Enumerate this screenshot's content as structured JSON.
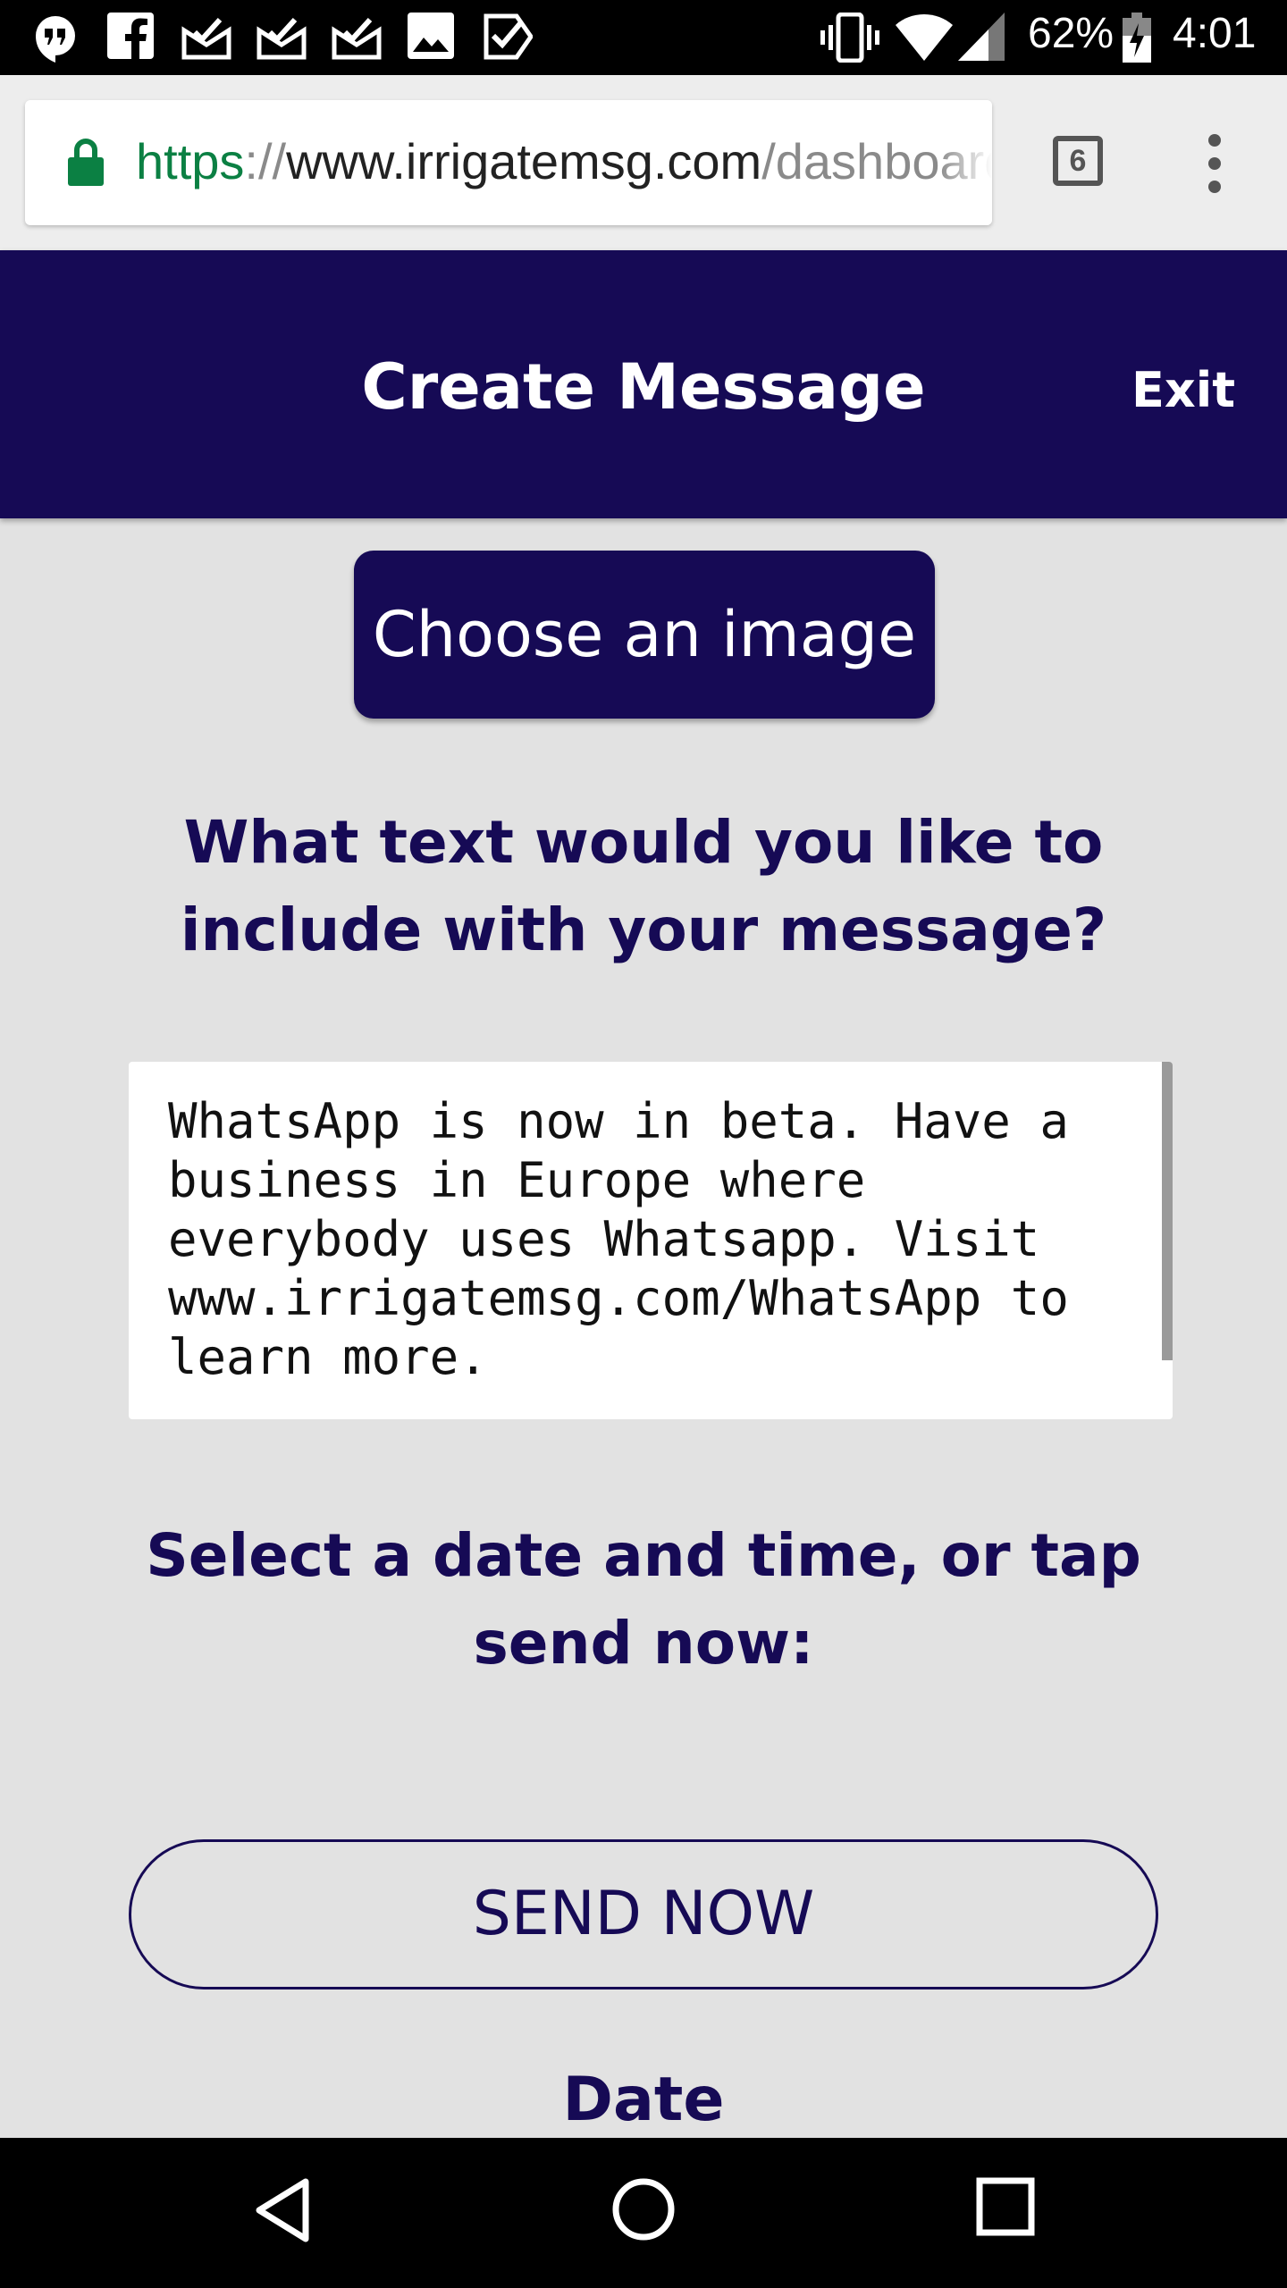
{
  "status_bar": {
    "battery": "62%",
    "time": "4:01"
  },
  "browser": {
    "url_scheme": "https",
    "url_separator": "://",
    "url_host": "www.irrigatemsg.com",
    "url_path": "/dashboard",
    "tab_count": "6"
  },
  "header": {
    "title": "Create Message",
    "exit_label": "Exit"
  },
  "main": {
    "choose_image_label": "Choose an image",
    "text_prompt": "What text would you like to include with your message?",
    "message_text": "WhatsApp is now in beta. Have a business in Europe where everybody uses Whatsapp. Visit www.irrigatemsg.com/WhatsApp to learn more.",
    "datetime_prompt": "Select a date and time, or tap send now:",
    "send_now_label": "SEND NOW",
    "date_label": "Date"
  },
  "colors": {
    "brand": "#160a55",
    "url_secure": "#0b8043",
    "background": "#e2e2e2"
  }
}
